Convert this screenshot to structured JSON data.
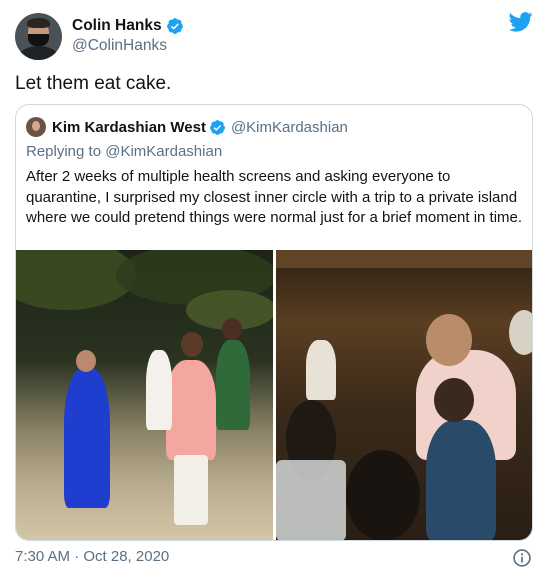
{
  "author": {
    "name": "Colin Hanks",
    "handle": "@ColinHanks",
    "verified": true
  },
  "tweet_text": "Let them eat cake.",
  "quoted_tweet": {
    "name": "Kim Kardashian West",
    "handle": "@KimKardashian",
    "verified": true,
    "reply_prefix": "Replying to",
    "reply_to": "@KimKardashian",
    "text": "After 2 weeks of multiple health screens and asking everyone to quarantine, I surprised my closest inner circle with a trip to a private island where we could pretend things were normal just for a brief moment in time."
  },
  "timestamp": "7:30 AM · Oct 28, 2020",
  "icons": {
    "platform": "twitter-bird-icon",
    "verified": "verified-badge-icon",
    "info": "info-icon"
  },
  "colors": {
    "brand": "#1da1f2",
    "secondary_text": "#5b7083",
    "border": "#cfd9de"
  }
}
